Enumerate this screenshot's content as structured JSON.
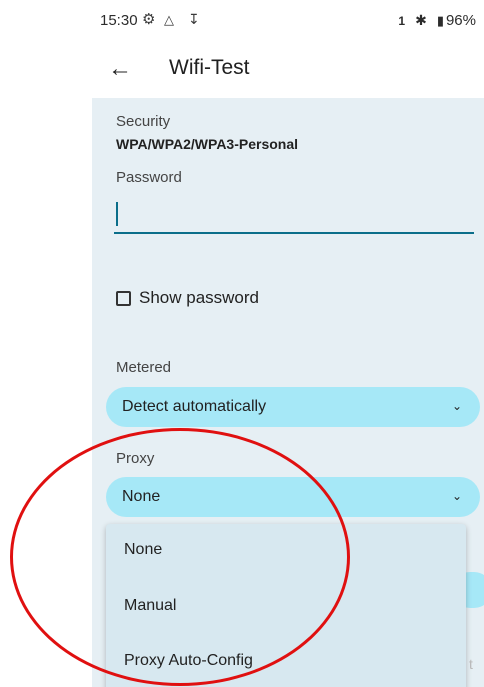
{
  "status_bar": {
    "time": "15:30",
    "signal": "1",
    "battery": "96%",
    "icons": [
      "gear-icon",
      "shield-icon",
      "download-icon",
      "bluetooth-icon",
      "battery-icon"
    ]
  },
  "app_bar": {
    "back_icon": "arrow-left-icon",
    "title": "Wifi-Test"
  },
  "form": {
    "security_label": "Security",
    "security_value": "WPA/WPA2/WPA3-Personal",
    "password_label": "Password",
    "password_value": "",
    "show_password_label": "Show password",
    "metered_label": "Metered",
    "metered_value": "Detect automatically",
    "proxy_label": "Proxy",
    "proxy_value": "None"
  },
  "proxy_menu": {
    "options": [
      "None",
      "Manual",
      "Proxy Auto-Config"
    ]
  },
  "colors": {
    "dropdown_fill": "#a6e8f7",
    "accent": "#0b6e8a",
    "annotation": "#e01010"
  }
}
